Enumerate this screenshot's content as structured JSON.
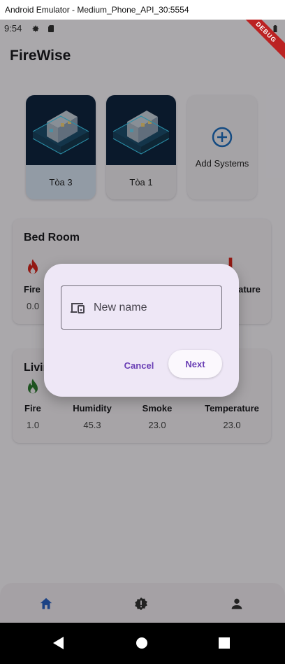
{
  "window": {
    "title": "Android Emulator - Medium_Phone_API_30:5554"
  },
  "status_bar": {
    "time": "9:54"
  },
  "debug_banner": "DEBUG",
  "app": {
    "title": "FireWise"
  },
  "systems": [
    {
      "label": "Tòa 3",
      "active": true
    },
    {
      "label": "Tòa 1",
      "active": false
    }
  ],
  "add_system": {
    "label": "Add Systems"
  },
  "rooms": [
    {
      "title": "Bed Room",
      "sensors": [
        {
          "name": "Fire",
          "value": "0.0"
        },
        {
          "name": "Temperature",
          "value": ""
        }
      ]
    },
    {
      "title": "Living Room",
      "sensors": [
        {
          "name": "Fire",
          "value": "1.0"
        },
        {
          "name": "Humidity",
          "value": "45.3"
        },
        {
          "name": "Smoke",
          "value": "23.0"
        },
        {
          "name": "Temperature",
          "value": "23.0"
        }
      ]
    }
  ],
  "dialog": {
    "input_placeholder": "New name",
    "input_value": "",
    "cancel_label": "Cancel",
    "next_label": "Next"
  },
  "bottom_nav": [
    {
      "icon": "home-icon",
      "active": true
    },
    {
      "icon": "alert-icon",
      "active": false
    },
    {
      "icon": "person-icon",
      "active": false
    }
  ],
  "colors": {
    "accent": "#6a3fb5",
    "fire": "#d9261c",
    "fire_ok": "#2e7d32",
    "home_active": "#2962c4"
  }
}
